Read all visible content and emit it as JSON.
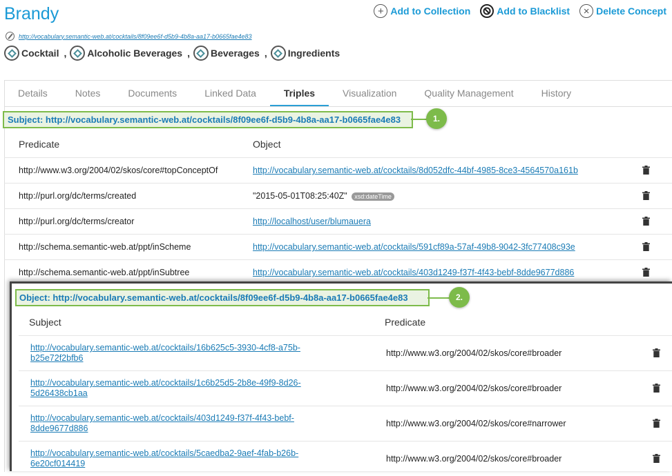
{
  "header": {
    "title": "Brandy",
    "actions": [
      {
        "label": "Add to Collection",
        "icon": "plus-circle-icon"
      },
      {
        "label": "Add to Blacklist",
        "icon": "blacklist-icon"
      },
      {
        "label": "Delete Concept",
        "icon": "x-circle-icon"
      }
    ],
    "uri": "http://vocabulary.semantic-web.at/cocktails/8f09ee6f-d5b9-4b8a-aa17-b0665fae4e83",
    "broaders": [
      "Cocktail",
      "Alcoholic Beverages",
      "Beverages",
      "Ingredients"
    ],
    "sep": ","
  },
  "tabs": [
    "Details",
    "Notes",
    "Documents",
    "Linked Data",
    "Triples",
    "Visualization",
    "Quality Management",
    "History"
  ],
  "active_tab": "Triples",
  "subject_section": {
    "label": "Subject: http://vocabulary.semantic-web.at/cocktails/8f09ee6f-d5b9-4b8a-aa17-b0665fae4e83",
    "callout": "1.",
    "col_predicate": "Predicate",
    "col_object": "Object",
    "rows": [
      {
        "predicate": "http://www.w3.org/2004/02/skos/core#topConceptOf",
        "object": "http://vocabulary.semantic-web.at/cocktails/8d052dfc-44bf-4985-8ce3-4564570a161b",
        "link": true
      },
      {
        "predicate": "http://purl.org/dc/terms/created",
        "object": "\"2015-05-01T08:25:40Z\"",
        "link": false,
        "datatype": "xsd:dateTime"
      },
      {
        "predicate": "http://purl.org/dc/terms/creator",
        "object": "http://localhost/user/blumauera",
        "link": true
      },
      {
        "predicate": "http://schema.semantic-web.at/ppt/inScheme",
        "object": "http://vocabulary.semantic-web.at/cocktails/591cf89a-57af-49b8-9042-3fc77408c93e",
        "link": true
      },
      {
        "predicate": "http://schema.semantic-web.at/ppt/inSubtree",
        "object": "http://vocabulary.semantic-web.at/cocktails/403d1249-f37f-4f43-bebf-8dde9677d886",
        "link": true
      }
    ]
  },
  "object_section": {
    "label": "Object: http://vocabulary.semantic-web.at/cocktails/8f09ee6f-d5b9-4b8a-aa17-b0665fae4e83",
    "callout": "2.",
    "col_subject": "Subject",
    "col_predicate": "Predicate",
    "rows": [
      {
        "subject": "http://vocabulary.semantic-web.at/cocktails/16b625c5-3930-4cf8-a75b-b25e72f2bfb6",
        "predicate": "http://www.w3.org/2004/02/skos/core#broader"
      },
      {
        "subject": "http://vocabulary.semantic-web.at/cocktails/1c6b25d5-2b8e-49f9-8d26-5d26438cb1aa",
        "predicate": "http://www.w3.org/2004/02/skos/core#broader"
      },
      {
        "subject": "http://vocabulary.semantic-web.at/cocktails/403d1249-f37f-4f43-bebf-8dde9677d886",
        "predicate": "http://www.w3.org/2004/02/skos/core#narrower"
      },
      {
        "subject": "http://vocabulary.semantic-web.at/cocktails/5caedba2-9aef-4fab-b26b-6e20cf014419",
        "predicate": "http://www.w3.org/2004/02/skos/core#broader"
      }
    ]
  },
  "colors": {
    "accent": "#1a9ad6",
    "link": "#1a7bb5",
    "callout": "#7dbb4a"
  }
}
